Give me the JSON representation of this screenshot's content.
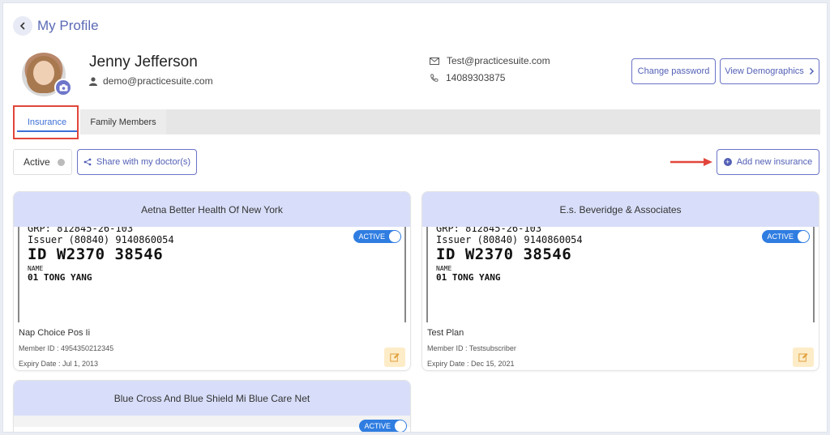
{
  "header": {
    "title": "My Profile"
  },
  "profile": {
    "name": "Jenny Jefferson",
    "login": "demo@practicesuite.com",
    "email": "Test@practicesuite.com",
    "phone": "14089303875"
  },
  "actions": {
    "change_password": "Change password",
    "view_demographics": "View Demographics"
  },
  "tabs": [
    {
      "label": "Insurance",
      "active": true
    },
    {
      "label": "Family Members",
      "active": false
    }
  ],
  "filters": {
    "status": "Active",
    "share": "Share with my doctor(s)",
    "add": "Add new insurance"
  },
  "card_image": {
    "line1": "GRP: 812845-26-103",
    "line2": "Issuer (80840) 9140860054",
    "line3": "ID  W2370 38546",
    "line4": "NAME",
    "line5": "01 TONG YANG"
  },
  "insurance_cards": [
    {
      "title": "Aetna Better Health Of New York",
      "status": "ACTIVE",
      "plan": "Nap Choice Pos Ii",
      "member_id": "Member ID : 4954350212345",
      "expiry": "Expiry Date : Jul 1, 2013"
    },
    {
      "title": "E.s. Beveridge & Associates",
      "status": "ACTIVE",
      "plan": "Test Plan",
      "member_id": "Member ID : Testsubscriber",
      "expiry": "Expiry Date : Dec 15, 2021"
    },
    {
      "title": "Blue Cross And Blue Shield Mi Blue Care Net",
      "status": "ACTIVE"
    }
  ],
  "colors": {
    "accent": "#5360b6",
    "toggle": "#2f7de1",
    "card_header": "#d8def9",
    "highlight": "#e2453b"
  }
}
